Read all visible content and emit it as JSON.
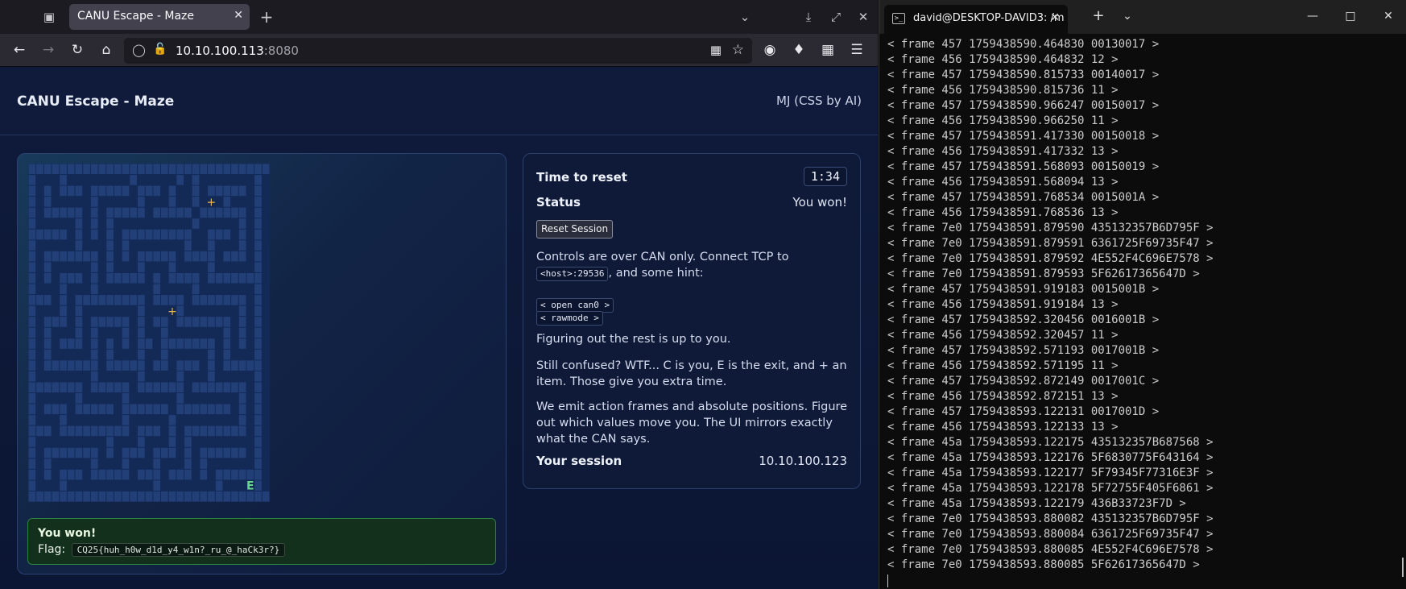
{
  "browser": {
    "tab_title": "CANU Escape - Maze",
    "url_host": "10.10.100.113",
    "url_port": ":8080"
  },
  "app": {
    "title": "CANU Escape - Maze",
    "credit": "MJ (CSS by AI)"
  },
  "maze": {
    "grid": [
      "###############################",
      "#...#........#.....#.#.......#.",
      "#.#.###.#####.###.#..#.#####.#.",
      "#.#.....#.....#...#..#...#...#.",
      "#.#####.#.#####.#####.######.#.",
      "#.....#.#.#..........#.....#.#.",
      "#####.#.#.#.#########..###.#.#.",
      "#.....#...#.#.......#..#...#.#.",
      "#.#######.#.#.#####.####.###.#.",
      "#.#.....#.#...#...#....#.....#.",
      "#.#.###.#.#####.#.####.#######.",
      "#...#...#.......#....#.......#.",
      "###.#.#########.####.#######.#.",
      "#...#.#.......#....#.......#.#.",
      "#.###.#.#####.#.##.#######.#.#.",
      "#.#...#.#...#.#..#.......#.#.#.",
      "#.#.###.#.#.#.##.#######.#.#.#.",
      "#.#.....#.#...#..#.....#.#...#.",
      "#.#######.#####.##.###.#.#####.",
      "#.......#.....#....#...#.....#.",
      "#######.#####.######.#######.#.",
      "#.....#.....#......#.......#.#.",
      "#.###.#####.######.#######.#.#.",
      "#...#.......#.....#........#.#.",
      "###.#########.###.#.########.#.",
      "#.........#...#...#.#........#.",
      "#.#######.#.###.###.#.######.#.",
      "#.#.....#...#...#...#.#......#.",
      "#.#.###.#####.###.###.#.######.",
      "#...#...........#.......#...E#.",
      "###############################"
    ],
    "items": [
      {
        "row": 3,
        "col": 23,
        "symbol": "+"
      },
      {
        "row": 13,
        "col": 18,
        "symbol": "+"
      }
    ],
    "exit_symbol": "E"
  },
  "win": {
    "title": "You won!",
    "flag_label": "Flag:",
    "flag": "CQ25{huh_h0w_d1d_y4_w1n?_ru_@_haCk3r?}"
  },
  "info": {
    "time_label": "Time to reset",
    "time_value": "1:34",
    "status_label": "Status",
    "status_value": "You won!",
    "reset_button": "Reset Session",
    "controls_text_1": "Controls are over CAN only. Connect TCP to",
    "controls_code": "<host>:29536",
    "controls_text_2": ", and some hint:",
    "hint_code_1": "< open can0 >",
    "hint_code_2": "< rawmode >",
    "rest_text": "Figuring out the rest is up to you.",
    "confused_text": "Still confused? WTF... C is you, E is the exit, and + an item. Those give you extra time.",
    "emit_text": "We emit action frames and absolute positions. Figure out which values move you. The UI mirrors exactly what the CAN says.",
    "session_label": "Your session",
    "session_value": "10.10.100.123"
  },
  "terminal": {
    "tab_title": "david@DESKTOP-DAVID3: /m",
    "lines": [
      "< frame 457 1759438590.464830 00130017 >",
      "< frame 456 1759438590.464832 12 >",
      "< frame 457 1759438590.815733 00140017 >",
      "< frame 456 1759438590.815736 11 >",
      "< frame 457 1759438590.966247 00150017 >",
      "< frame 456 1759438590.966250 11 >",
      "< frame 457 1759438591.417330 00150018 >",
      "< frame 456 1759438591.417332 13 >",
      "< frame 457 1759438591.568093 00150019 >",
      "< frame 456 1759438591.568094 13 >",
      "< frame 457 1759438591.768534 0015001A >",
      "< frame 456 1759438591.768536 13 >",
      "< frame 7e0 1759438591.879590 435132357B6D795F >",
      "< frame 7e0 1759438591.879591 6361725F69735F47 >",
      "< frame 7e0 1759438591.879592 4E552F4C696E7578 >",
      "< frame 7e0 1759438591.879593 5F62617365647D >",
      "< frame 457 1759438591.919183 0015001B >",
      "< frame 456 1759438591.919184 13 >",
      "< frame 457 1759438592.320456 0016001B >",
      "< frame 456 1759438592.320457 11 >",
      "< frame 457 1759438592.571193 0017001B >",
      "< frame 456 1759438592.571195 11 >",
      "< frame 457 1759438592.872149 0017001C >",
      "< frame 456 1759438592.872151 13 >",
      "< frame 457 1759438593.122131 0017001D >",
      "< frame 456 1759438593.122133 13 >",
      "< frame 45a 1759438593.122175 435132357B687568 >",
      "< frame 45a 1759438593.122176 5F6830775F643164 >",
      "< frame 45a 1759438593.122177 5F79345F77316E3F >",
      "< frame 45a 1759438593.122178 5F72755F405F6861 >",
      "< frame 45a 1759438593.122179 436B33723F7D >",
      "< frame 7e0 1759438593.880082 435132357B6D795F >",
      "< frame 7e0 1759438593.880084 6361725F69735F47 >",
      "< frame 7e0 1759438593.880085 4E552F4C696E7578 >",
      "< frame 7e0 1759438593.880085 5F62617365647D >"
    ]
  },
  "colors": {
    "maze_wall": "#223f78",
    "maze_path": "#132a57",
    "item": "#e7b84f",
    "exit": "#69d88a"
  }
}
